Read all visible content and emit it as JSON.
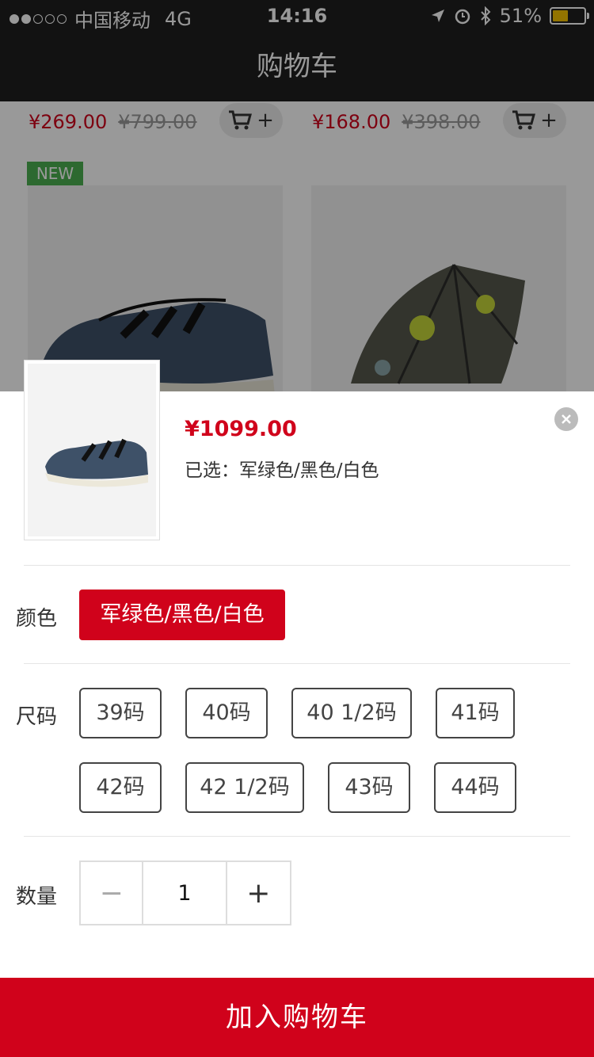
{
  "status_bar": {
    "carrier": "中国移动",
    "network": "4G",
    "time": "14:16",
    "battery": "51%",
    "battery_level": 0.51
  },
  "nav": {
    "title": "购物车"
  },
  "background": {
    "products": [
      {
        "price": "¥269.00",
        "old_price": "¥799.00"
      },
      {
        "price": "¥168.00",
        "old_price": "¥398.00"
      }
    ],
    "new_tag": "NEW"
  },
  "sheet": {
    "price": "¥1099.00",
    "selected_label": "已选：",
    "selected_value": "军绿色/黑色/白色",
    "color_label": "颜色",
    "color_option": "军绿色/黑色/白色",
    "size_label": "尺码",
    "sizes": [
      "39码",
      "40码",
      "40 1/2码",
      "41码",
      "42码",
      "42 1/2码",
      "43码",
      "44码"
    ],
    "qty_label": "数量",
    "qty_minus": "−",
    "qty_value": "1",
    "qty_plus": "+",
    "add_button": "加入购物车"
  },
  "colors": {
    "accent": "#d0021b",
    "nav_bg": "#1f1f1f",
    "new_tag": "#4caf50"
  }
}
